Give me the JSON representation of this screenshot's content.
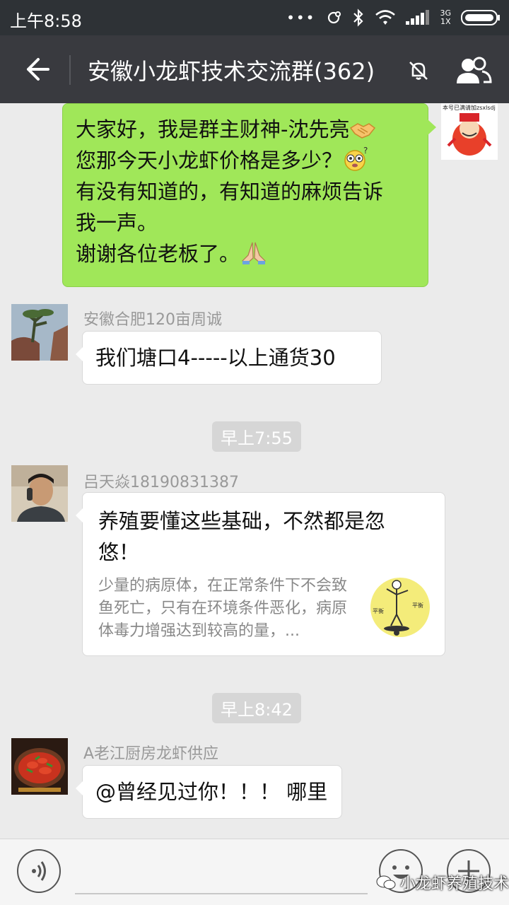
{
  "status_bar": {
    "time": "上午8:58",
    "network": "3G\n1X",
    "dots": "•••"
  },
  "header": {
    "title": "安徽小龙虾技术交流群(362)",
    "icons": [
      "back-arrow-icon",
      "mute-bell-icon",
      "group-members-icon"
    ]
  },
  "messages": [
    {
      "type": "text",
      "side": "right",
      "lines": [
        "大家好，我是群主财神-沈先亮",
        "您那今天小龙虾价格是多少？",
        "有没有知道的，有知道的麻烦告诉",
        "我一声。",
        "谢谢各位老板了。"
      ],
      "avatar_caption": "本号已满请加zsxlsdj",
      "emojis": [
        "handshake-emoji",
        "confused-face-emoji",
        "folded-hands-emoji"
      ]
    },
    {
      "type": "text",
      "side": "left",
      "sender": "安徽合肥120亩周诚",
      "text": "我们塘口4-----以上通货30"
    },
    {
      "type": "time",
      "text": "早上7:55"
    },
    {
      "type": "link",
      "side": "left",
      "sender": "吕天焱18190831387",
      "title": "养殖要懂这些基础，不然都是忽悠！",
      "description": "少量的病原体，在正常条件下不会致鱼死亡，只有在环境条件恶化，病原体毒力增强达到较高的量，..."
    },
    {
      "type": "time",
      "text": "早上8:42"
    },
    {
      "type": "text",
      "side": "left",
      "sender": "A老江厨房龙虾供应",
      "text": "@曾经见过你！！！ 哪里"
    }
  ],
  "input_bar": {
    "icons": [
      "voice-icon",
      "emoji-icon",
      "plus-icon"
    ]
  },
  "watermark": "小龙虾养殖技术",
  "colors": {
    "status_bar": "#2e3236",
    "title_bar": "#393a3f",
    "chat_bg": "#ebebeb",
    "sent_bubble": "#a0e759"
  }
}
